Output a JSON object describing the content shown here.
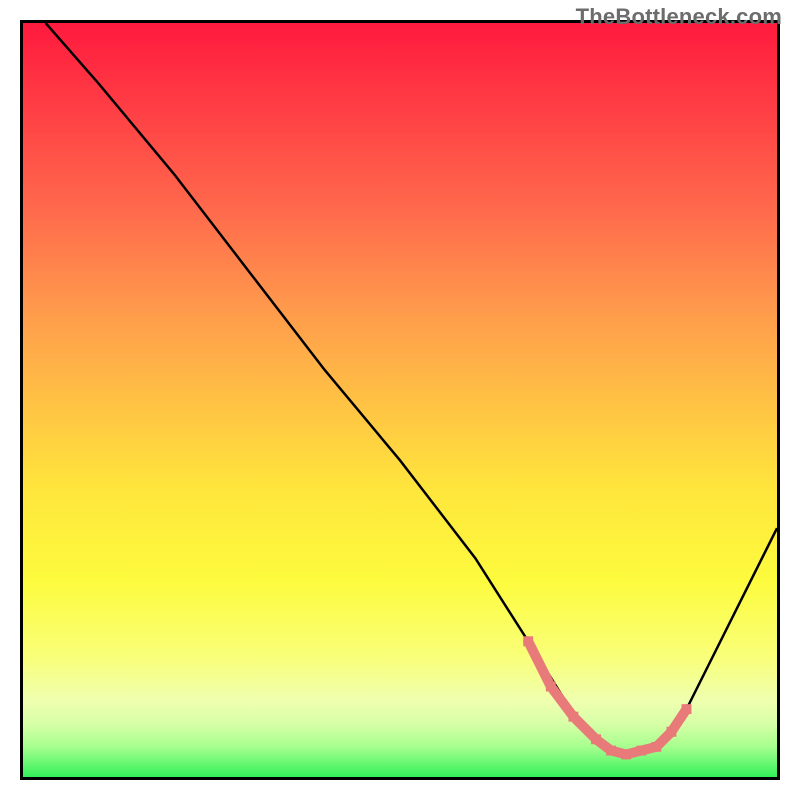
{
  "watermark": "TheBottleneck.com",
  "chart_data": {
    "type": "line",
    "title": "",
    "xlabel": "",
    "ylabel": "",
    "xlim": [
      0,
      100
    ],
    "ylim": [
      0,
      100
    ],
    "series": [
      {
        "name": "main-curve",
        "color": "#000000",
        "x": [
          3,
          10,
          20,
          30,
          40,
          50,
          60,
          67,
          72,
          76,
          80,
          84,
          88,
          100
        ],
        "y": [
          100,
          92,
          80,
          67,
          54,
          42,
          29,
          18,
          10,
          5,
          3,
          4,
          9,
          33
        ]
      },
      {
        "name": "highlight-segment",
        "color": "#e97a7a",
        "x": [
          67,
          70,
          73,
          76,
          78,
          80,
          82,
          84,
          86,
          88
        ],
        "y": [
          18,
          12,
          8,
          5,
          3.5,
          3,
          3.5,
          4,
          6,
          9
        ]
      }
    ],
    "gradient_stops": [
      {
        "pos": 0,
        "color": "#ff1a3e"
      },
      {
        "pos": 10,
        "color": "#ff3a44"
      },
      {
        "pos": 25,
        "color": "#ff6a4c"
      },
      {
        "pos": 38,
        "color": "#ff9a4c"
      },
      {
        "pos": 50,
        "color": "#ffc144"
      },
      {
        "pos": 62,
        "color": "#ffe63c"
      },
      {
        "pos": 74,
        "color": "#fdfb3e"
      },
      {
        "pos": 84,
        "color": "#f9ff78"
      },
      {
        "pos": 90,
        "color": "#efffb0"
      },
      {
        "pos": 93,
        "color": "#d6ffa6"
      },
      {
        "pos": 96,
        "color": "#a6ff8e"
      },
      {
        "pos": 100,
        "color": "#33f05a"
      }
    ],
    "annotations": []
  }
}
